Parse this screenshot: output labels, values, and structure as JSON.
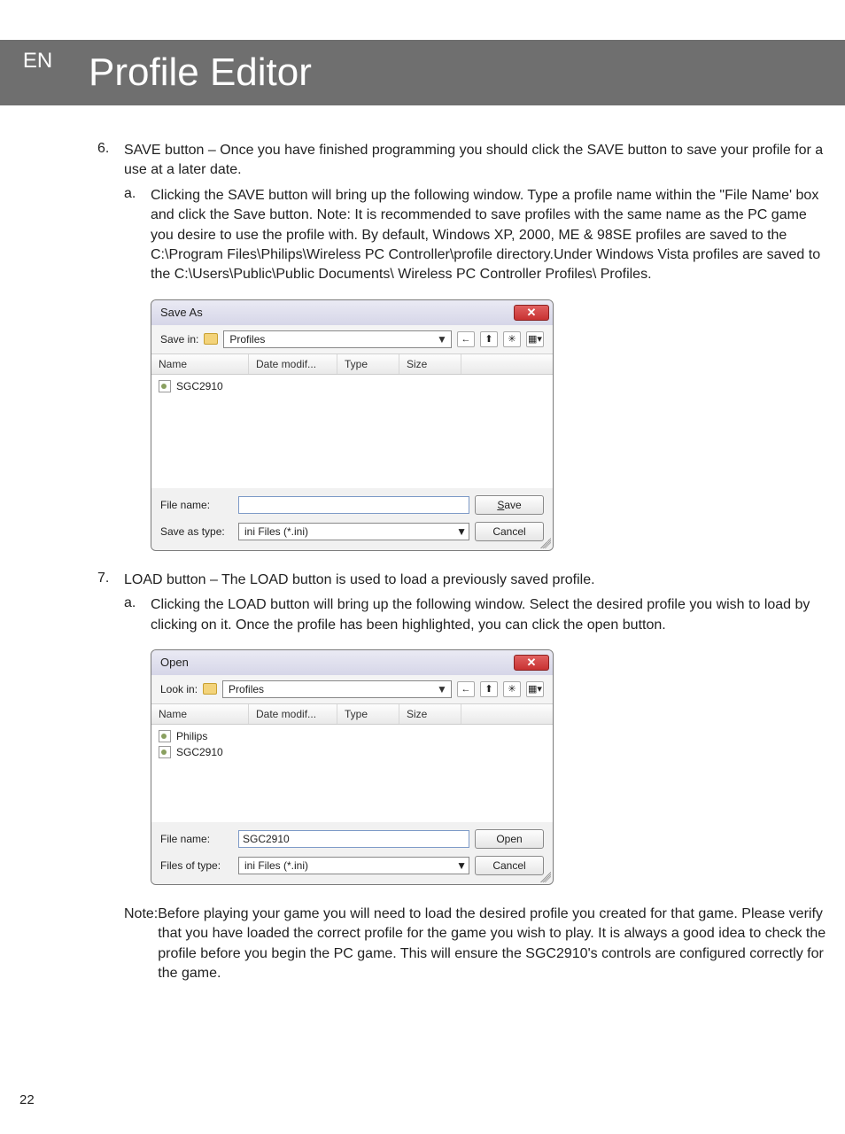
{
  "lang_tab": "EN",
  "header_title": "Profile Editor",
  "page_number": "22",
  "step6": {
    "num": "6.",
    "text": "SAVE button – Once you have finished programming you should click the SAVE button to save your profile for a use at a later date.",
    "a_label": "a.",
    "a_text": "Clicking the SAVE button will bring up the following window. Type a profile name within the \"File Name' box and click the Save button. Note: It is recommended to save profiles with the same name as the PC game you desire to use the profile with. By default, Windows XP, 2000, ME & 98SE profiles are saved to the C:\\Program Files\\Philips\\Wireless PC Controller\\profile directory.Under Windows Vista profiles are saved to the C:\\Users\\Public\\Public Documents\\ Wireless PC Controller Profiles\\ Profiles."
  },
  "step7": {
    "num": "7.",
    "text": "LOAD button – The LOAD button is used to load a previously saved profile.",
    "a_label": "a.",
    "a_text": "Clicking the LOAD button will bring up the following window. Select the desired profile you wish to load by clicking on it. Once the profile has been highlighted, you can click the open button."
  },
  "note": {
    "label": "Note: ",
    "text": "Before playing your game you will need to load the desired profile you created for that game. Please verify that you have loaded the correct profile for the game you wish to play. It is always a good idea to check the profile before you begin the PC game. This will ensure the SGC2910's controls are configured correctly for the game."
  },
  "dialog_common": {
    "cols": {
      "name": "Name",
      "date": "Date modif...",
      "type": "Type",
      "size": "Size"
    },
    "folder_name": "Profiles",
    "file_type_text": "ini Files (*.ini)",
    "cancel": "Cancel"
  },
  "save_dialog": {
    "title": "Save As",
    "location_label": "Save in:",
    "files": [
      "SGC2910"
    ],
    "filename_label": "File name:",
    "filename_value": "",
    "type_label": "Save as type:",
    "action_btn": "Save",
    "action_u": "S",
    "action_rest": "ave"
  },
  "open_dialog": {
    "title": "Open",
    "location_label": "Look in:",
    "files": [
      "Philips",
      "SGC2910"
    ],
    "filename_label": "File name:",
    "filename_value": "SGC2910",
    "type_label": "Files of type:",
    "action_btn": "Open"
  }
}
